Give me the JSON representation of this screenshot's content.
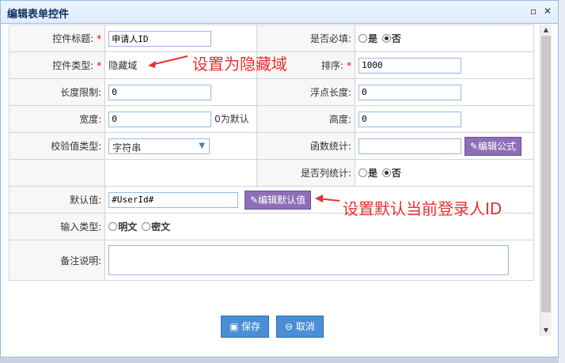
{
  "dialog": {
    "title": "编辑表单控件"
  },
  "fields": {
    "control_title": {
      "label": "控件标题:",
      "value": "申请人ID"
    },
    "required": {
      "label": "是否必填:",
      "yes": "是",
      "no": "否"
    },
    "control_type": {
      "label": "控件类型:",
      "value": "隐藏域"
    },
    "sort": {
      "label": "排序:",
      "value": "1000"
    },
    "length_limit": {
      "label": "长度限制:",
      "value": "0"
    },
    "float_length": {
      "label": "浮点长度:",
      "value": "0"
    },
    "width": {
      "label": "宽度:",
      "value": "0",
      "hint": "0为默认"
    },
    "height": {
      "label": "高度:",
      "value": "0"
    },
    "validate_type": {
      "label": "校验值类型:",
      "value": "字符串"
    },
    "function_stat": {
      "label": "函数统计:",
      "value": "",
      "button": "编辑公式"
    },
    "column_stat": {
      "label": "是否列统计:",
      "yes": "是",
      "no": "否"
    },
    "default_value": {
      "label": "默认值:",
      "value": "#UserId#",
      "button": "编辑默认值"
    },
    "input_type": {
      "label": "输入类型:",
      "plain": "明文",
      "secret": "密文"
    },
    "remark": {
      "label": "备注说明:",
      "value": ""
    }
  },
  "buttons": {
    "save": "保存",
    "cancel": "取消"
  },
  "annotations": {
    "hidden": "设置为隐藏域",
    "default_user": "设置默认当前登录人ID"
  },
  "colors": {
    "annotation": "#e8312e",
    "purple_button": "#8e6fb7",
    "blue_button": "#4a8fd5"
  }
}
